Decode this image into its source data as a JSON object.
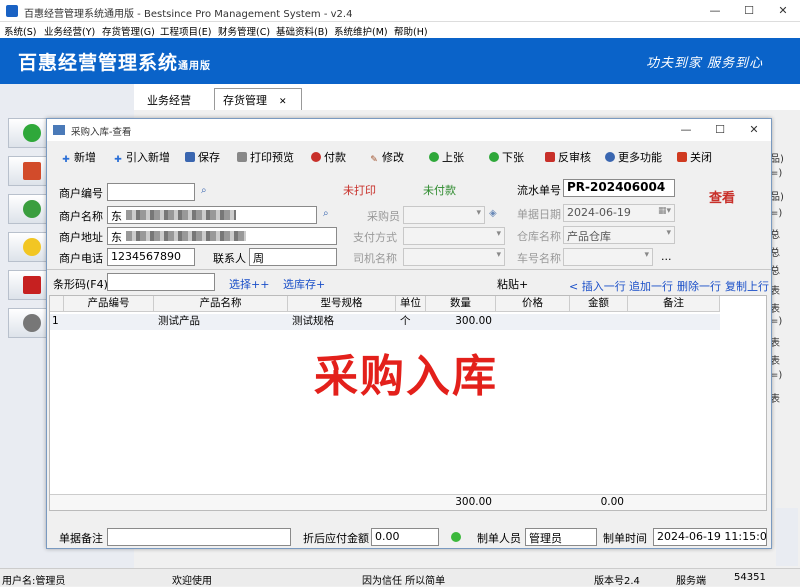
{
  "app": {
    "window_title": "百惠经营管理系统通用版 - Bestsince Pro Management System - v2.4",
    "menu": [
      "系统(S)",
      "业务经营(Y)",
      "存货管理(G)",
      "工程项目(E)",
      "财务管理(C)",
      "基础资料(B)",
      "系统维护(M)",
      "帮助(H)"
    ],
    "banner_title": "百惠经营管理系统",
    "banner_suffix": "通用版",
    "banner_motto": "功夫到家  服务到心",
    "tabs": [
      "业务经营",
      "存货管理"
    ],
    "right_strip": [
      "品)",
      "=)",
      "品)",
      "=)",
      "总",
      "总",
      "总",
      "表",
      "表",
      "=)",
      "表",
      "表",
      "=)",
      "表"
    ]
  },
  "dialog": {
    "title": "采购入库-查看",
    "toolbar": [
      {
        "label": "新增",
        "icon": "plus-icon"
      },
      {
        "label": "引入新增",
        "icon": "plus-icon"
      },
      {
        "label": "保存",
        "icon": "save-icon"
      },
      {
        "label": "打印预览",
        "icon": "print-icon"
      },
      {
        "label": "付款",
        "icon": "payment-icon"
      },
      {
        "label": "修改",
        "icon": "edit-icon"
      },
      {
        "label": "上张",
        "icon": "up-icon"
      },
      {
        "label": "下张",
        "icon": "down-icon"
      },
      {
        "label": "反审核",
        "icon": "unaudit-icon"
      },
      {
        "label": "更多功能",
        "icon": "more-icon"
      },
      {
        "label": "关闭",
        "icon": "close-icon"
      }
    ],
    "status_print": "未打印",
    "status_pay": "未付款",
    "mode": "查看",
    "fields": {
      "customer_no_label": "商户编号",
      "customer_no": "",
      "customer_name_label": "商户名称",
      "customer_name": "东",
      "customer_addr_label": "商户地址",
      "customer_addr": "东",
      "customer_phone_label": "商户电话",
      "customer_phone": "1234567890",
      "contact_label": "联系人",
      "contact": "周",
      "purchaser_label": "采购员",
      "purchaser": "",
      "pay_method_label": "支付方式",
      "pay_method": "",
      "driver_label": "司机名称",
      "driver": "",
      "serial_label": "流水单号",
      "serial": "PR-202406004",
      "date_label": "单据日期",
      "date": "2024-06-19",
      "warehouse_label": "仓库名称",
      "warehouse": "产品仓库",
      "car_label": "车号名称",
      "car": "",
      "ellipsis": "..."
    },
    "barcode_label": "条形码(F4)",
    "barcode": "",
    "links": [
      "选择++",
      "选库存+"
    ],
    "paste": "粘贴+",
    "row_actions": [
      "< 插入一行",
      "追加一行",
      "删除一行",
      "复制上行"
    ],
    "grid": {
      "headers": [
        "产品编号",
        "产品名称",
        "型号规格",
        "单位",
        "数量",
        "价格",
        "金额",
        "备注"
      ],
      "rows": [
        {
          "no": "1",
          "code": "",
          "name": "测试产品",
          "spec": "测试规格",
          "unit": "个",
          "qty": "300.00",
          "price": "",
          "amount": "",
          "remark": ""
        }
      ],
      "watermark": "采购入库",
      "total_qty": "300.00",
      "total_amount": "0.00"
    },
    "footer": {
      "remark_label": "单据备注",
      "remark": "",
      "payable_label": "折后应付金额",
      "payable": "0.00",
      "maker_label": "制单人员",
      "maker": "管理员",
      "time_label": "制单时间",
      "time": "2024-06-19 11:15:07"
    }
  },
  "statusbar": {
    "user": "用户名:管理员",
    "welcome": "欢迎使用",
    "slogan": "因为信任 所以简单",
    "version": "版本号2.4",
    "server": "服务端",
    "port": "54351"
  }
}
